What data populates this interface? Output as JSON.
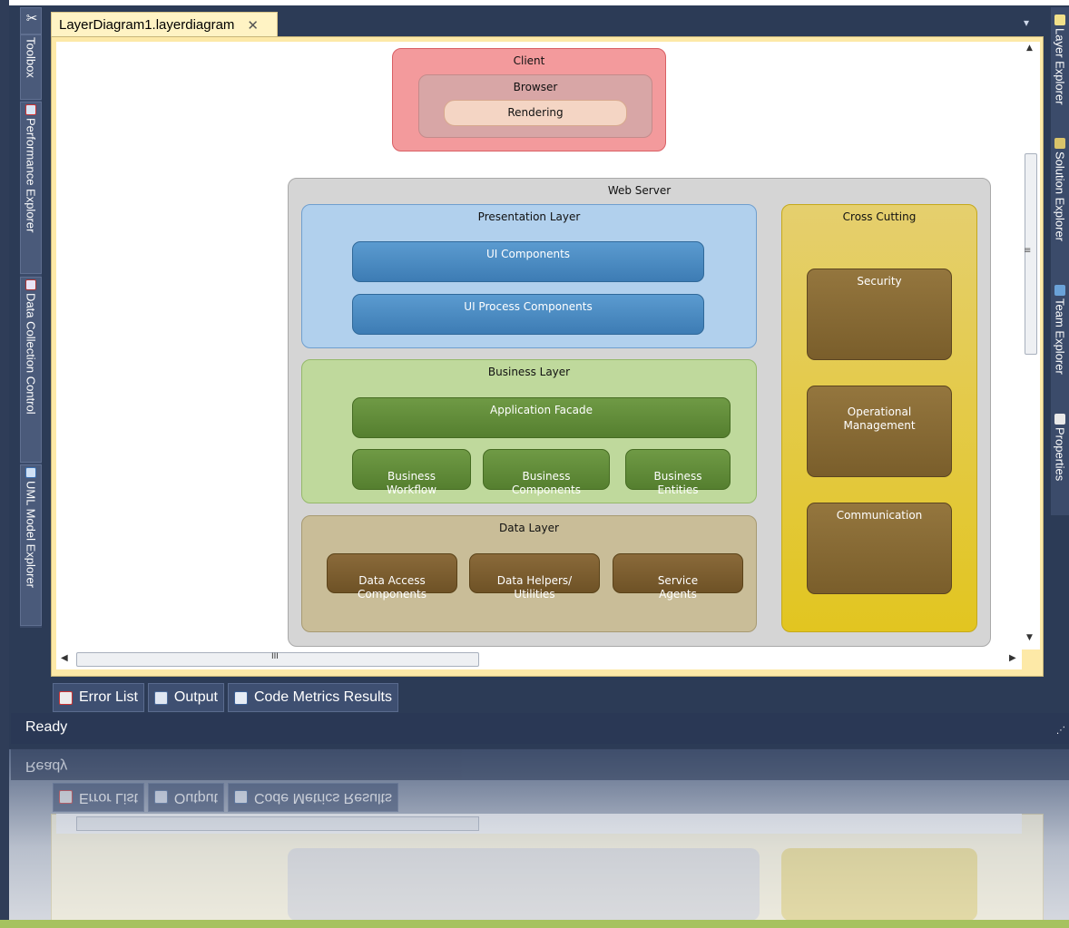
{
  "window": {
    "document_tab": "LayerDiagram1.layerdiagram",
    "close_glyph": "✕",
    "status": "Ready",
    "tab_dropdown_glyph": "▾"
  },
  "left_tabs": [
    {
      "label": "Toolbox",
      "icon": "toolbox-icon"
    },
    {
      "label": "Performance Explorer",
      "icon": "performance-icon"
    },
    {
      "label": "Data Collection Control",
      "icon": "data-collection-icon"
    },
    {
      "label": "UML Model Explorer",
      "icon": "uml-explorer-icon"
    }
  ],
  "right_tabs": [
    {
      "label": "Layer Explorer",
      "icon": "layer-explorer-icon"
    },
    {
      "label": "Solution Explorer",
      "icon": "solution-explorer-icon"
    },
    {
      "label": "Team Explorer",
      "icon": "team-explorer-icon"
    },
    {
      "label": "Properties",
      "icon": "properties-icon"
    }
  ],
  "bottom_tabs": [
    {
      "label": "Error List",
      "icon": "error-list-icon"
    },
    {
      "label": "Output",
      "icon": "output-icon"
    },
    {
      "label": "Code Metrics Results",
      "icon": "code-metrics-icon"
    }
  ],
  "diagram": {
    "client": {
      "label": "Client",
      "browser": {
        "label": "Browser",
        "rendering": "Rendering"
      }
    },
    "web_server": {
      "label": "Web Server",
      "presentation": {
        "label": "Presentation Layer",
        "components": [
          "UI Components",
          "UI Process Components"
        ]
      },
      "business": {
        "label": "Business Layer",
        "facade": "Application Facade",
        "components": [
          "Business\nWorkflow",
          "Business\nComponents",
          "Business\nEntities"
        ]
      },
      "data": {
        "label": "Data Layer",
        "components": [
          "Data Access\nComponents",
          "Data Helpers/\nUtilities",
          "Service\nAgents"
        ]
      },
      "cross_cutting": {
        "label": "Cross Cutting",
        "components": [
          "Security",
          "Operational\nManagement",
          "Communication"
        ]
      }
    }
  },
  "scrollbars": {
    "h_grip": "III",
    "v_grip": "≡"
  },
  "colors": {
    "client": "#f08a8e",
    "presentation": "#aecdeb",
    "business": "#bdd79a",
    "data": "#c8bc97",
    "cross_cutting": "#e8cf4a",
    "web_server": "#d4d4d4"
  }
}
